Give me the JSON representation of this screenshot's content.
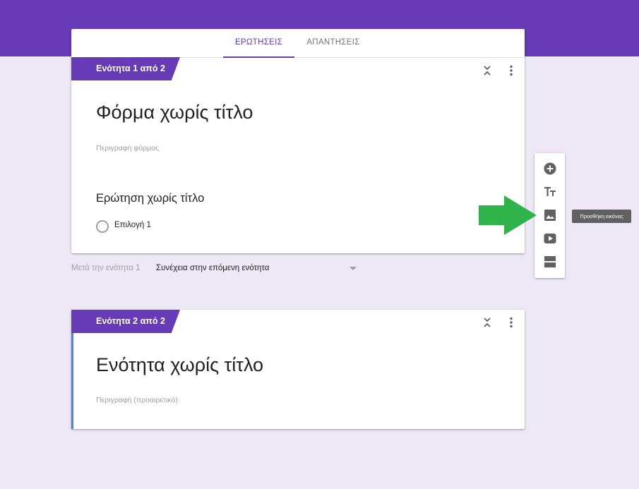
{
  "tabs": [
    {
      "label": "ΕΡΩΤΗΣΕΙΣ",
      "active": true
    },
    {
      "label": "ΑΠΑΝΤΗΣΕΙΣ",
      "active": false
    }
  ],
  "section1": {
    "flag": "Ενότητα 1 από 2",
    "form_title": "Φόρμα χωρίς τίτλο",
    "form_description_placeholder": "Περιγραφή φόρμας",
    "question": {
      "title": "Ερώτηση χωρίς τίτλο",
      "options": [
        {
          "label": "Επιλογή 1"
        }
      ]
    },
    "icons": [
      "collapse-icon",
      "more-vert-icon"
    ]
  },
  "after_section": {
    "label": "Μετά την ενότητα 1",
    "selected": "Συνέχεια στην επόμενη ενότητα"
  },
  "section2": {
    "flag": "Ενότητα 2 από 2",
    "title": "Ενότητα χωρίς τίτλο",
    "description_placeholder": "Περιγραφή (προαιρετικό)",
    "icons": [
      "collapse-icon",
      "more-vert-icon"
    ]
  },
  "toolbar": {
    "tools": [
      "add-question-icon",
      "add-title-icon",
      "add-image-icon",
      "add-video-icon",
      "add-section-icon"
    ],
    "tooltip": "Προσθήκη εικόνας"
  },
  "colors": {
    "header": "#673ab7",
    "background": "#ede7f6",
    "accent_blue": "#4285f4",
    "pointer_arrow": "#2fb34a"
  }
}
